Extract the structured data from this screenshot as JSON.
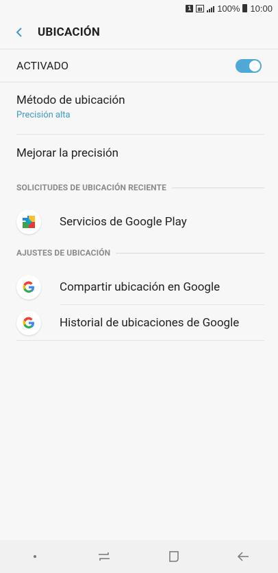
{
  "status_bar": {
    "sim_label": "1",
    "battery": "100%",
    "time": "10:00"
  },
  "header": {
    "title": "UBICACIÓN",
    "back_icon": "chevron-left-icon"
  },
  "toggle": {
    "label": "ACTIVADO",
    "state": "on",
    "color": "#4ea8d8"
  },
  "items": [
    {
      "title": "Método de ubicación",
      "subtitle": "Precisión alta"
    },
    {
      "title": "Mejorar la precisión"
    }
  ],
  "sections": {
    "recent": {
      "header": "SOLICITUDES DE UBICACIÓN RECIENTE",
      "apps": [
        {
          "label": "Servicios de Google Play",
          "icon": "google-play-services-icon"
        }
      ]
    },
    "settings": {
      "header": "AJUSTES DE UBICACIÓN",
      "apps": [
        {
          "label": "Compartir ubicación en Google",
          "icon": "google-g-icon"
        },
        {
          "label": "Historial de ubicaciones de Google",
          "icon": "google-g-icon"
        }
      ]
    }
  },
  "nav": {
    "icons": [
      "dot-icon",
      "recents-icon",
      "home-icon",
      "back-arrow-icon"
    ]
  },
  "colors": {
    "accent": "#3e9ac7",
    "background": "#f7f7f7"
  }
}
